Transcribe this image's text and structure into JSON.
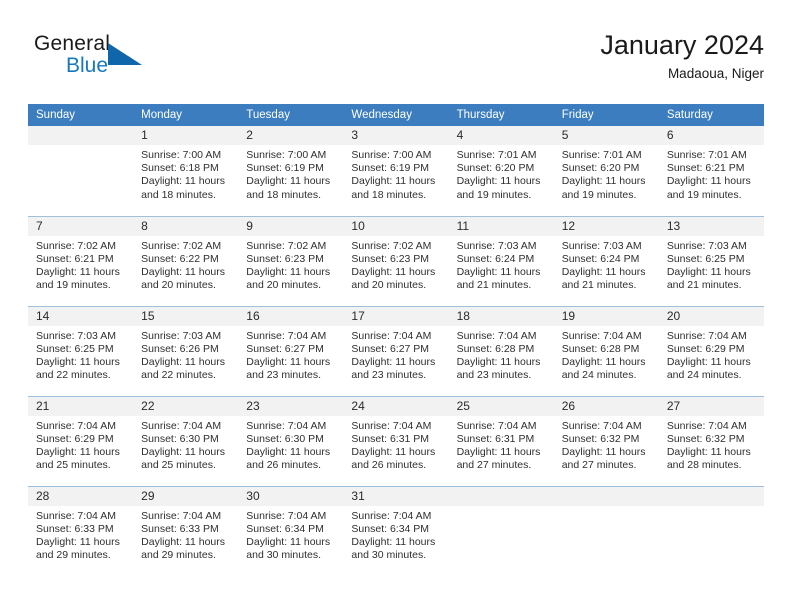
{
  "brand": {
    "name_top": "General",
    "name_bottom": "Blue",
    "accent_color": "#1878be",
    "triangle_color": "#1066aa"
  },
  "header": {
    "title": "January 2024",
    "subtitle": "Madaoua, Niger",
    "header_bg": "#3b7dbf",
    "daynum_bg": "#f2f2f2"
  },
  "weekdays": [
    "Sunday",
    "Monday",
    "Tuesday",
    "Wednesday",
    "Thursday",
    "Friday",
    "Saturday"
  ],
  "weeks": [
    [
      {
        "day": "",
        "sunrise": "",
        "sunset": "",
        "daylight1": "",
        "daylight2": ""
      },
      {
        "day": "1",
        "sunrise": "Sunrise: 7:00 AM",
        "sunset": "Sunset: 6:18 PM",
        "daylight1": "Daylight: 11 hours",
        "daylight2": "and 18 minutes."
      },
      {
        "day": "2",
        "sunrise": "Sunrise: 7:00 AM",
        "sunset": "Sunset: 6:19 PM",
        "daylight1": "Daylight: 11 hours",
        "daylight2": "and 18 minutes."
      },
      {
        "day": "3",
        "sunrise": "Sunrise: 7:00 AM",
        "sunset": "Sunset: 6:19 PM",
        "daylight1": "Daylight: 11 hours",
        "daylight2": "and 18 minutes."
      },
      {
        "day": "4",
        "sunrise": "Sunrise: 7:01 AM",
        "sunset": "Sunset: 6:20 PM",
        "daylight1": "Daylight: 11 hours",
        "daylight2": "and 19 minutes."
      },
      {
        "day": "5",
        "sunrise": "Sunrise: 7:01 AM",
        "sunset": "Sunset: 6:20 PM",
        "daylight1": "Daylight: 11 hours",
        "daylight2": "and 19 minutes."
      },
      {
        "day": "6",
        "sunrise": "Sunrise: 7:01 AM",
        "sunset": "Sunset: 6:21 PM",
        "daylight1": "Daylight: 11 hours",
        "daylight2": "and 19 minutes."
      }
    ],
    [
      {
        "day": "7",
        "sunrise": "Sunrise: 7:02 AM",
        "sunset": "Sunset: 6:21 PM",
        "daylight1": "Daylight: 11 hours",
        "daylight2": "and 19 minutes."
      },
      {
        "day": "8",
        "sunrise": "Sunrise: 7:02 AM",
        "sunset": "Sunset: 6:22 PM",
        "daylight1": "Daylight: 11 hours",
        "daylight2": "and 20 minutes."
      },
      {
        "day": "9",
        "sunrise": "Sunrise: 7:02 AM",
        "sunset": "Sunset: 6:23 PM",
        "daylight1": "Daylight: 11 hours",
        "daylight2": "and 20 minutes."
      },
      {
        "day": "10",
        "sunrise": "Sunrise: 7:02 AM",
        "sunset": "Sunset: 6:23 PM",
        "daylight1": "Daylight: 11 hours",
        "daylight2": "and 20 minutes."
      },
      {
        "day": "11",
        "sunrise": "Sunrise: 7:03 AM",
        "sunset": "Sunset: 6:24 PM",
        "daylight1": "Daylight: 11 hours",
        "daylight2": "and 21 minutes."
      },
      {
        "day": "12",
        "sunrise": "Sunrise: 7:03 AM",
        "sunset": "Sunset: 6:24 PM",
        "daylight1": "Daylight: 11 hours",
        "daylight2": "and 21 minutes."
      },
      {
        "day": "13",
        "sunrise": "Sunrise: 7:03 AM",
        "sunset": "Sunset: 6:25 PM",
        "daylight1": "Daylight: 11 hours",
        "daylight2": "and 21 minutes."
      }
    ],
    [
      {
        "day": "14",
        "sunrise": "Sunrise: 7:03 AM",
        "sunset": "Sunset: 6:25 PM",
        "daylight1": "Daylight: 11 hours",
        "daylight2": "and 22 minutes."
      },
      {
        "day": "15",
        "sunrise": "Sunrise: 7:03 AM",
        "sunset": "Sunset: 6:26 PM",
        "daylight1": "Daylight: 11 hours",
        "daylight2": "and 22 minutes."
      },
      {
        "day": "16",
        "sunrise": "Sunrise: 7:04 AM",
        "sunset": "Sunset: 6:27 PM",
        "daylight1": "Daylight: 11 hours",
        "daylight2": "and 23 minutes."
      },
      {
        "day": "17",
        "sunrise": "Sunrise: 7:04 AM",
        "sunset": "Sunset: 6:27 PM",
        "daylight1": "Daylight: 11 hours",
        "daylight2": "and 23 minutes."
      },
      {
        "day": "18",
        "sunrise": "Sunrise: 7:04 AM",
        "sunset": "Sunset: 6:28 PM",
        "daylight1": "Daylight: 11 hours",
        "daylight2": "and 23 minutes."
      },
      {
        "day": "19",
        "sunrise": "Sunrise: 7:04 AM",
        "sunset": "Sunset: 6:28 PM",
        "daylight1": "Daylight: 11 hours",
        "daylight2": "and 24 minutes."
      },
      {
        "day": "20",
        "sunrise": "Sunrise: 7:04 AM",
        "sunset": "Sunset: 6:29 PM",
        "daylight1": "Daylight: 11 hours",
        "daylight2": "and 24 minutes."
      }
    ],
    [
      {
        "day": "21",
        "sunrise": "Sunrise: 7:04 AM",
        "sunset": "Sunset: 6:29 PM",
        "daylight1": "Daylight: 11 hours",
        "daylight2": "and 25 minutes."
      },
      {
        "day": "22",
        "sunrise": "Sunrise: 7:04 AM",
        "sunset": "Sunset: 6:30 PM",
        "daylight1": "Daylight: 11 hours",
        "daylight2": "and 25 minutes."
      },
      {
        "day": "23",
        "sunrise": "Sunrise: 7:04 AM",
        "sunset": "Sunset: 6:30 PM",
        "daylight1": "Daylight: 11 hours",
        "daylight2": "and 26 minutes."
      },
      {
        "day": "24",
        "sunrise": "Sunrise: 7:04 AM",
        "sunset": "Sunset: 6:31 PM",
        "daylight1": "Daylight: 11 hours",
        "daylight2": "and 26 minutes."
      },
      {
        "day": "25",
        "sunrise": "Sunrise: 7:04 AM",
        "sunset": "Sunset: 6:31 PM",
        "daylight1": "Daylight: 11 hours",
        "daylight2": "and 27 minutes."
      },
      {
        "day": "26",
        "sunrise": "Sunrise: 7:04 AM",
        "sunset": "Sunset: 6:32 PM",
        "daylight1": "Daylight: 11 hours",
        "daylight2": "and 27 minutes."
      },
      {
        "day": "27",
        "sunrise": "Sunrise: 7:04 AM",
        "sunset": "Sunset: 6:32 PM",
        "daylight1": "Daylight: 11 hours",
        "daylight2": "and 28 minutes."
      }
    ],
    [
      {
        "day": "28",
        "sunrise": "Sunrise: 7:04 AM",
        "sunset": "Sunset: 6:33 PM",
        "daylight1": "Daylight: 11 hours",
        "daylight2": "and 29 minutes."
      },
      {
        "day": "29",
        "sunrise": "Sunrise: 7:04 AM",
        "sunset": "Sunset: 6:33 PM",
        "daylight1": "Daylight: 11 hours",
        "daylight2": "and 29 minutes."
      },
      {
        "day": "30",
        "sunrise": "Sunrise: 7:04 AM",
        "sunset": "Sunset: 6:34 PM",
        "daylight1": "Daylight: 11 hours",
        "daylight2": "and 30 minutes."
      },
      {
        "day": "31",
        "sunrise": "Sunrise: 7:04 AM",
        "sunset": "Sunset: 6:34 PM",
        "daylight1": "Daylight: 11 hours",
        "daylight2": "and 30 minutes."
      },
      {
        "day": "",
        "sunrise": "",
        "sunset": "",
        "daylight1": "",
        "daylight2": ""
      },
      {
        "day": "",
        "sunrise": "",
        "sunset": "",
        "daylight1": "",
        "daylight2": ""
      },
      {
        "day": "",
        "sunrise": "",
        "sunset": "",
        "daylight1": "",
        "daylight2": ""
      }
    ]
  ]
}
